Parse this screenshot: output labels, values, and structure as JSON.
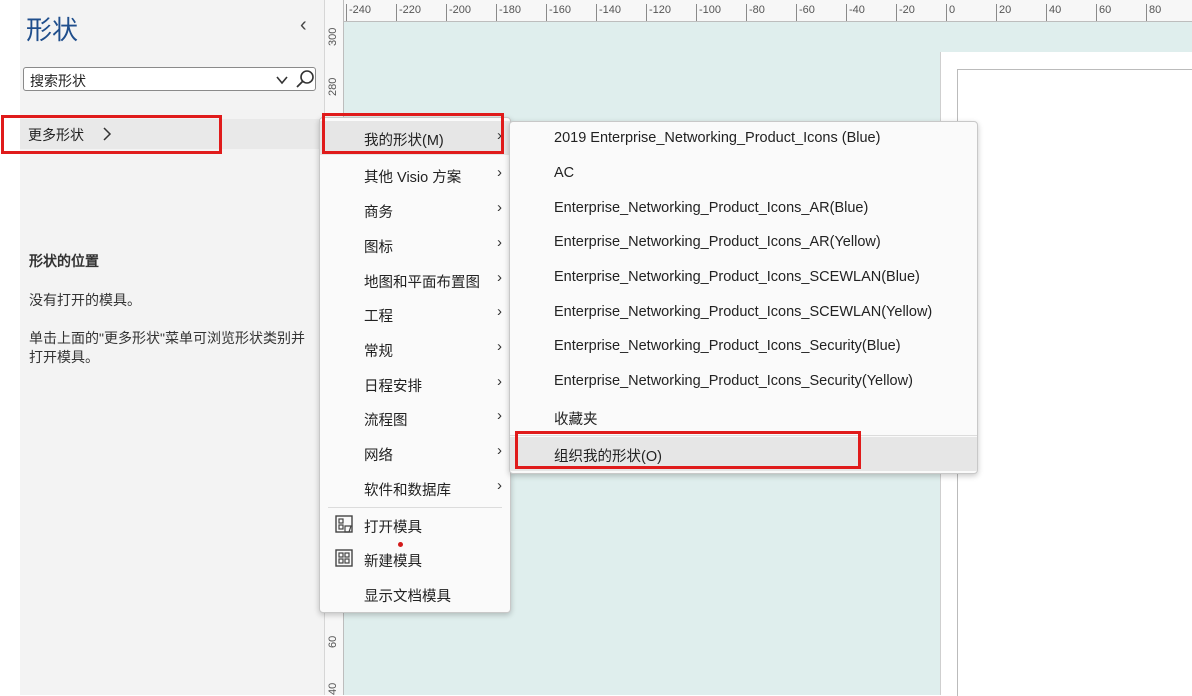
{
  "pane": {
    "title": "形状",
    "collapse_icon": "‹",
    "search_placeholder": "搜索形状",
    "more_shapes": "更多形状",
    "location_title": "形状的位置",
    "location_none": "没有打开的模具。",
    "location_hint": "单击上面的\"更多形状\"菜单可浏览形状类别并打开模具。"
  },
  "ruler": {
    "horizontal": [
      "-240",
      "-220",
      "-200",
      "-180",
      "-160",
      "-140",
      "-120",
      "-100",
      "-80",
      "-60",
      "-40",
      "-20",
      "0",
      "20",
      "40",
      "60",
      "80"
    ],
    "vertical_top": [
      "300",
      "280"
    ],
    "vertical_bottom": [
      "60",
      "40"
    ]
  },
  "menu1": {
    "items": [
      {
        "label": "我的形状(M)",
        "submenu": true
      },
      {
        "label": "其他 Visio 方案",
        "submenu": true
      },
      {
        "label": "商务",
        "submenu": true
      },
      {
        "label": "图标",
        "submenu": true
      },
      {
        "label": "地图和平面布置图",
        "submenu": true
      },
      {
        "label": "工程",
        "submenu": true
      },
      {
        "label": "常规",
        "submenu": true
      },
      {
        "label": "日程安排",
        "submenu": true
      },
      {
        "label": "流程图",
        "submenu": true
      },
      {
        "label": "网络",
        "submenu": true
      },
      {
        "label": "软件和数据库",
        "submenu": true
      }
    ],
    "actions": [
      {
        "label": "打开模具",
        "icon": "open-stencil-icon"
      },
      {
        "label": "新建模具",
        "icon": "new-stencil-icon"
      },
      {
        "label": "显示文档模具",
        "icon": ""
      }
    ]
  },
  "menu2": {
    "items": [
      "2019 Enterprise_Networking_Product_Icons (Blue)",
      "AC",
      "Enterprise_Networking_Product_Icons_AR(Blue)",
      "Enterprise_Networking_Product_Icons_AR(Yellow)",
      "Enterprise_Networking_Product_Icons_SCEWLAN(Blue)",
      "Enterprise_Networking_Product_Icons_SCEWLAN(Yellow)",
      "Enterprise_Networking_Product_Icons_Security(Blue)",
      "Enterprise_Networking_Product_Icons_Security(Yellow)",
      "收藏夹"
    ],
    "organize": "组织我的形状(O)"
  },
  "colors": {
    "accent": "#1f4e8c",
    "highlight": "#e01b1b",
    "canvas": "#dfeeed"
  }
}
